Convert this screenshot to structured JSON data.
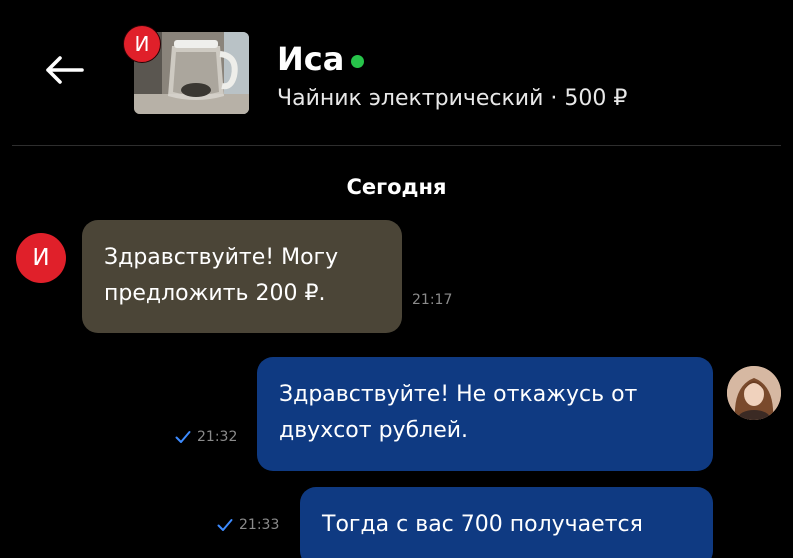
{
  "header": {
    "back_icon": "arrow-left-icon",
    "seller_badge_letter": "И",
    "contact_name": "Иса",
    "online_status_color": "#27c44a",
    "listing": "Чайник электрический · 500 ₽"
  },
  "chat": {
    "date_label": "Сегодня",
    "messages": [
      {
        "direction": "incoming",
        "avatar_letter": "И",
        "text": "Здравствуйте! Могу\nпредложить 200 ₽.",
        "time": "21:17"
      },
      {
        "direction": "outgoing",
        "text": "Здравствуйте! Не откажусь от\nдвухсот рублей.",
        "time": "21:32",
        "status_icon": "check-icon"
      },
      {
        "direction": "outgoing",
        "text": "Тогда с вас 700 получается",
        "time": "21:33",
        "status_icon": "check-icon"
      }
    ]
  },
  "colors": {
    "background": "#000000",
    "incoming_bubble": "#4b4537",
    "outgoing_bubble": "#0f3a82",
    "badge_red": "#e0202a",
    "check_blue": "#3d8bff"
  }
}
